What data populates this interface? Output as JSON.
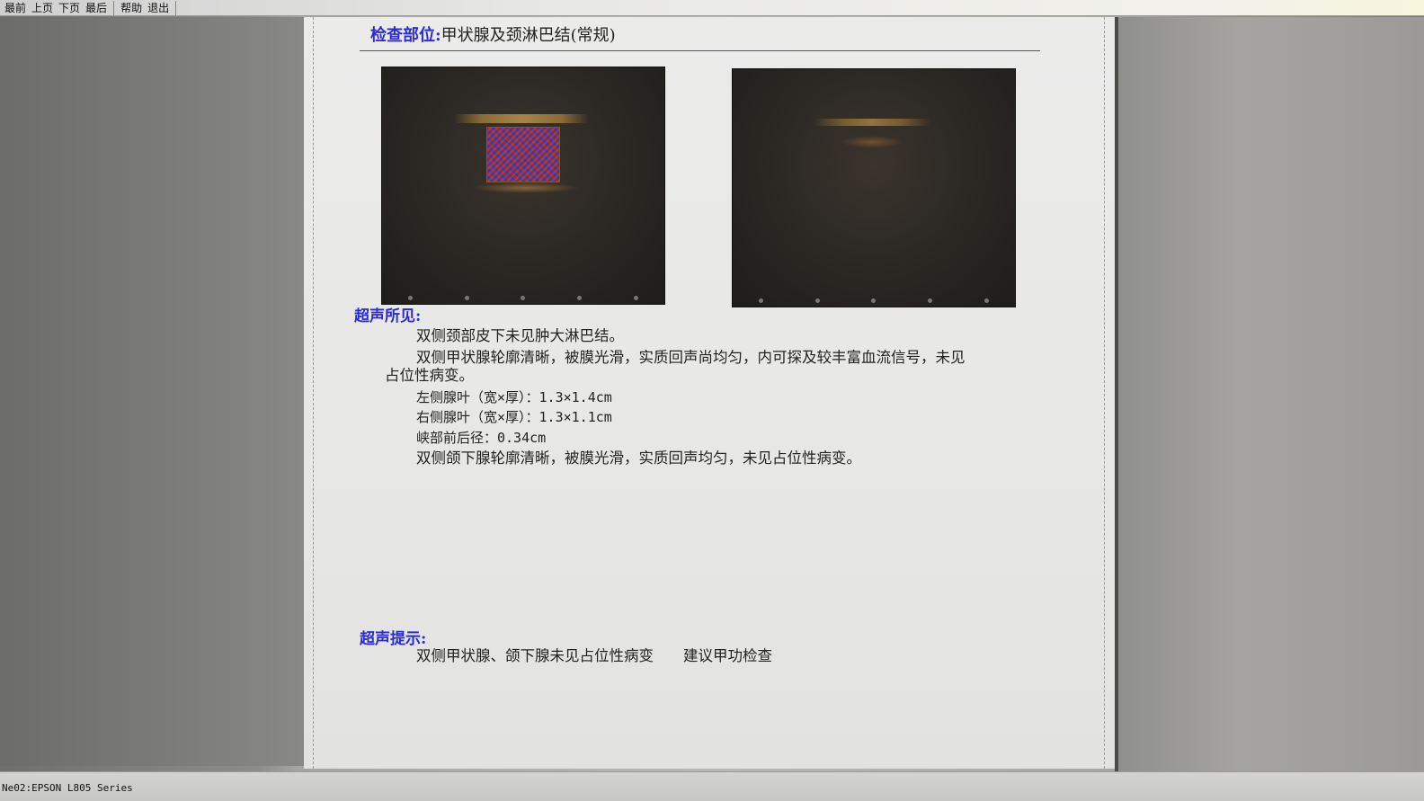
{
  "toolbar": {
    "buttons": [
      "最前",
      "上页",
      "下页",
      "最后",
      "帮助",
      "退出"
    ]
  },
  "report": {
    "exam_label": "检查部位:",
    "exam_value": "甲状腺及颈淋巴结(常规)",
    "findings_title": "超声所见:",
    "findings": {
      "line1": "双侧颈部皮下未见肿大淋巴结。",
      "line2a": "双侧甲状腺轮廓清晰，被膜光滑，实质回声尚均匀，内可探及较丰富血流信号，未见",
      "line2b": "占位性病变。",
      "line3": "左侧腺叶（宽×厚）：1.3×1.4cm",
      "line4": "右侧腺叶（宽×厚）：1.3×1.1cm",
      "line5": "峡部前后径：0.34cm",
      "line6": "双侧颌下腺轮廓清晰，被膜光滑，实质回声均匀，未见占位性病变。"
    },
    "impression_title": "超声提示:",
    "impression": "双侧甲状腺、颌下腺未见占位性病变　　建议甲功检查"
  },
  "status_bar": {
    "printer": "Ne02:EPSON L805 Series"
  },
  "colors": {
    "label_blue": "#2b2bd6",
    "text": "#222222",
    "paper": "#e9e9e7"
  }
}
